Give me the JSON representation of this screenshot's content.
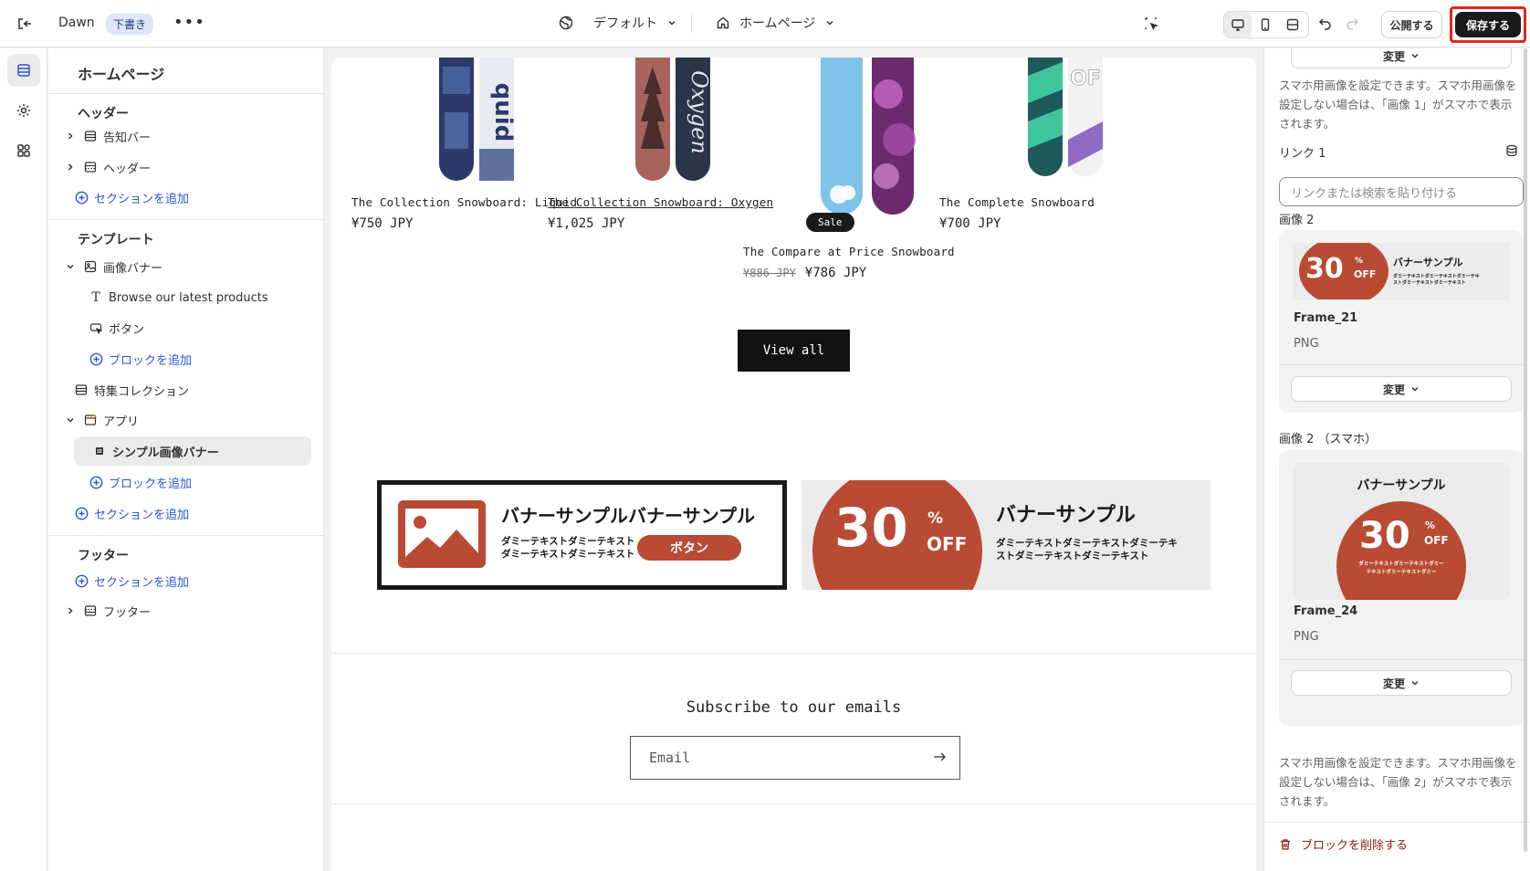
{
  "topbar": {
    "theme_name": "Dawn",
    "draft_badge": "下書き",
    "more_label": "•••",
    "theme_preset": "デフォルト",
    "page_selector": "ホームページ",
    "publish_label": "公開する",
    "save_label": "保存する"
  },
  "sidebar": {
    "title": "ホームページ",
    "header_group": "ヘッダー",
    "announcement_bar": "告知バー",
    "header_item": "ヘッダー",
    "add_section_1": "セクションを追加",
    "template_group": "テンプレート",
    "image_banner": "画像バナー",
    "block_text": "Browse our latest products",
    "block_button": "ボタン",
    "add_block_1": "ブロックを追加",
    "featured_collection": "特集コレクション",
    "apps": "アプリ",
    "simple_banner": "シンプル画像バナー",
    "add_block_2": "ブロックを追加",
    "add_section_2": "セクションを追加",
    "footer_group": "フッター",
    "add_section_3": "セクションを追加",
    "footer_item": "フッター"
  },
  "canvas": {
    "products": [
      {
        "name": "The Collection Snowboard: Liquid",
        "price": "¥750 JPY"
      },
      {
        "name": "The Collection Snowboard: Oxygen",
        "price": "¥1,025 JPY"
      },
      {
        "name": "The Compare at Price Snowboard",
        "old_price": "¥886 JPY",
        "price": "¥786 JPY",
        "badge": "Sale"
      },
      {
        "name": "The Complete Snowboard",
        "price": "¥700 JPY"
      }
    ],
    "view_all": "View all",
    "banner1": {
      "title": "バナーサンプルバナーサンプル",
      "body_line1": "ダミーテキストダミーテキスト",
      "body_line2": "ダミーテキストダミーテキスト",
      "button": "ボタン"
    },
    "banner2": {
      "number": "30",
      "percent": "%",
      "off": "OFF",
      "title": "バナーサンプル",
      "body_line1": "ダミーテキストダミーテキストダミーテキ",
      "body_line2": "ストダミーテキストダミーテキスト"
    },
    "subscribe_title": "Subscribe to our emails",
    "email_placeholder": "Email"
  },
  "panel": {
    "change_label": "変更",
    "help_top": "スマホ用画像を設定できます。スマホ用画像を設定しない場合は、「画像 1」がスマホで表示されます。",
    "link_label": "リンク 1",
    "link_placeholder": "リンクまたは検索を貼り付ける",
    "image2_label": "画像 2",
    "image2_file": "Frame_21",
    "image2_type": "PNG",
    "thumb1": {
      "number": "30",
      "percent": "%",
      "off": "OFF",
      "title": "バナーサンプル",
      "body_line1": "ダミーテキストダミーテキストダミーテキ",
      "body_line2": "ストダミーテキストダミーテキスト"
    },
    "image2m_label": "画像 2 （スマホ）",
    "image2m_file": "Frame_24",
    "image2m_type": "PNG",
    "thumb2": {
      "title": "バナーサンプル",
      "number": "30",
      "percent": "%",
      "off": "OFF",
      "body_line1": "ダミーテキストダミーテキストダミー",
      "body_line2": "テキストダミーテキストダミー"
    },
    "help_bottom": "スマホ用画像を設定できます。スマホ用画像を設定しない場合は、「画像 2」がスマホで表示されます。",
    "delete_label": "ブロックを削除する"
  },
  "colors": {
    "accent_blue": "#2b56d8",
    "save_outline": "#e0261b",
    "banner_red": "#b94a33",
    "delete_red": "#8e1f0b"
  }
}
